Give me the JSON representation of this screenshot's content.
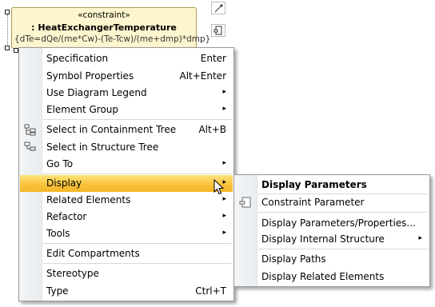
{
  "diagram": {
    "stereotype": "«constraint»",
    "name": ": HeatExchangerTemperature",
    "expression": "{dTe=dQe/(me*Cw)-(Te-Tcw)/(me+dmp)*dmp}"
  },
  "context_menu": {
    "items": [
      {
        "label": "Specification",
        "accelerator": "Enter"
      },
      {
        "label": "Symbol Properties",
        "accelerator": "Alt+Enter"
      },
      {
        "label": "Use Diagram Legend",
        "arrow": "▸"
      },
      {
        "label": "Element Group",
        "arrow": "▸"
      },
      {
        "label": "Select in Containment Tree",
        "accelerator": "Alt+B",
        "icon": "containment-tree-icon"
      },
      {
        "label": "Select in Structure Tree",
        "icon": "structure-tree-icon"
      },
      {
        "label": "Go To",
        "arrow": "▸"
      },
      {
        "label": "Display",
        "arrow": "▸",
        "highlighted": true
      },
      {
        "label": "Related Elements",
        "arrow": "▸"
      },
      {
        "label": "Refactor",
        "arrow": "▸"
      },
      {
        "label": "Tools",
        "arrow": "▸"
      },
      {
        "label": "Edit Compartments"
      },
      {
        "label": "Stereotype"
      },
      {
        "label": "Type",
        "accelerator": "Ctrl+T"
      }
    ]
  },
  "submenu": {
    "items": [
      {
        "label": "Display Parameters",
        "bold": true
      },
      {
        "label": "Constraint Parameter",
        "icon": "constraint-parameter-icon"
      },
      {
        "label": "Display Parameters/Properties..."
      },
      {
        "label": "Display Internal Structure",
        "arrow": "▸"
      },
      {
        "label": "Display Paths"
      },
      {
        "label": "Display Related Elements"
      }
    ]
  },
  "colors": {
    "highlight_top": "#fde47c",
    "highlight_bottom": "#f5b626",
    "constraint_fill": "#fdf5ce",
    "constraint_border": "#a99a56"
  }
}
